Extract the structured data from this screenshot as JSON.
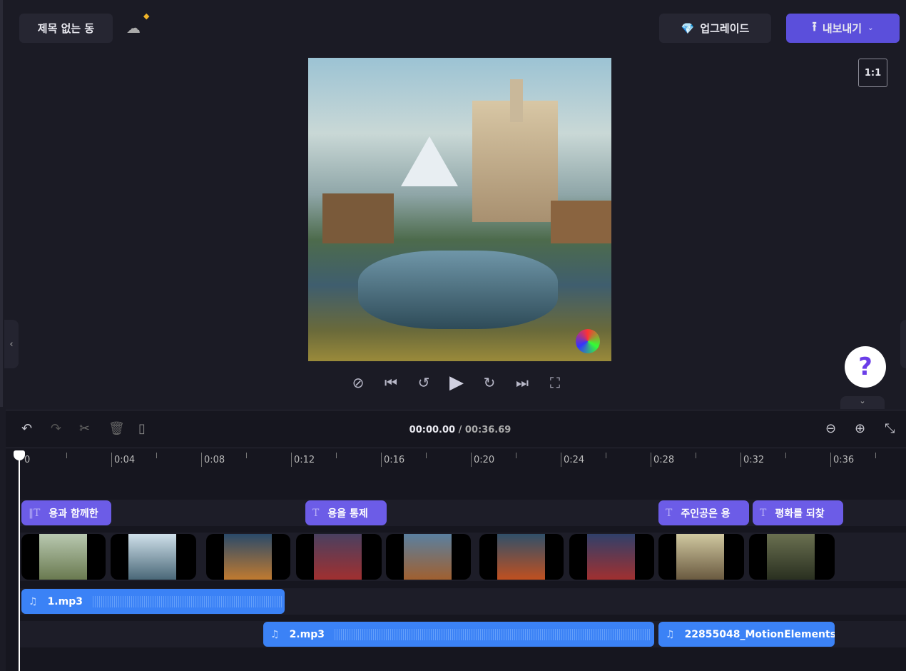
{
  "header": {
    "project_title": "제목 없는 동",
    "upgrade_label": "업그레이드",
    "export_label": "내보내기",
    "ratio_label": "1:1"
  },
  "player": {
    "help_label": "?"
  },
  "timeline": {
    "current_time": "00:00.00",
    "total_time": "/ 00:36.69",
    "ruler": [
      "0",
      "0:04",
      "0:08",
      "0:12",
      "0:16",
      "0:20",
      "0:24",
      "0:28",
      "0:32",
      "0:36"
    ],
    "text_clips": [
      "용과 함께한",
      "용을 통제",
      "주인공은 용",
      "평화를 되찾"
    ],
    "audio_clips": [
      "1.mp3",
      "2.mp3",
      "22855048_MotionElements"
    ]
  },
  "colors": {
    "accent": "#5b4fdb",
    "text_clip": "#6c5ce7",
    "audio_clip": "#3b82f6"
  }
}
